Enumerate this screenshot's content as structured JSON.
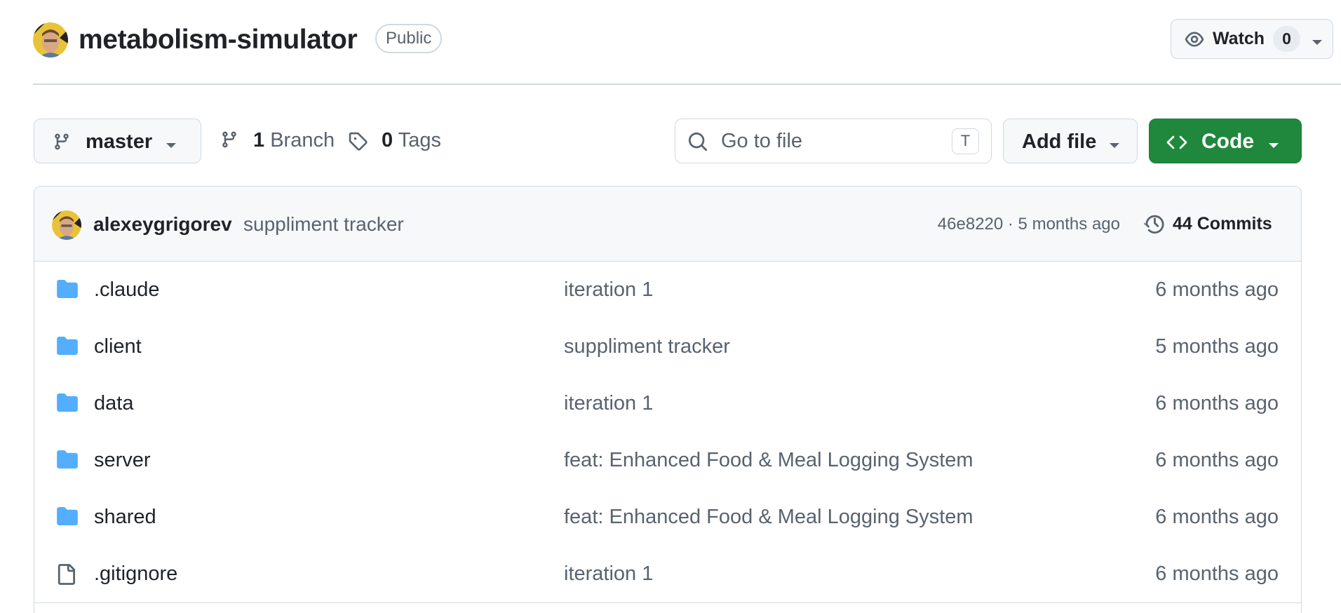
{
  "repo": {
    "name": "metabolism-simulator",
    "visibility": "Public"
  },
  "watch": {
    "label": "Watch",
    "count": "0"
  },
  "branch": {
    "current": "master"
  },
  "branches": {
    "count": "1",
    "label": "Branch"
  },
  "tags": {
    "count": "0",
    "label": "Tags"
  },
  "search": {
    "placeholder": "Go to file",
    "shortcut": "T"
  },
  "add_file": {
    "label": "Add file"
  },
  "code": {
    "label": "Code"
  },
  "latest_commit": {
    "author": "alexeygrigorev",
    "message": "suppliment tracker",
    "meta": "46e8220 · 5 months ago",
    "commits_label": "44 Commits"
  },
  "files": [
    {
      "name": ".claude",
      "type": "folder",
      "message": "iteration 1",
      "date": "6 months ago"
    },
    {
      "name": "client",
      "type": "folder",
      "message": "suppliment tracker",
      "date": "5 months ago"
    },
    {
      "name": "data",
      "type": "folder",
      "message": "iteration 1",
      "date": "6 months ago"
    },
    {
      "name": "server",
      "type": "folder",
      "message": "feat: Enhanced Food & Meal Logging System",
      "date": "6 months ago"
    },
    {
      "name": "shared",
      "type": "folder",
      "message": "feat: Enhanced Food & Meal Logging System",
      "date": "6 months ago"
    },
    {
      "name": ".gitignore",
      "type": "file",
      "message": "iteration 1",
      "date": "6 months ago"
    }
  ],
  "colors": {
    "code_button": "#1f883d",
    "folder_icon": "#54aeff",
    "border": "#d1d9e0",
    "muted_text": "#59636e"
  }
}
